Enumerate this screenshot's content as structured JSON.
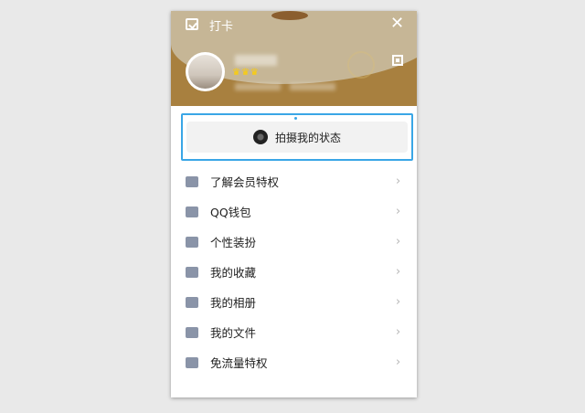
{
  "header": {
    "checkin_label": "打卡",
    "close_glyph": "✕",
    "crowns": "♛♛♛",
    "accent_color": "#a8803f"
  },
  "status": {
    "label": "拍摄我的状态",
    "border_color": "#3aa6e6"
  },
  "menu": {
    "items": [
      {
        "label": "了解会员特权",
        "icon": "vip-icon"
      },
      {
        "label": "QQ钱包",
        "icon": "wallet-icon"
      },
      {
        "label": "个性装扮",
        "icon": "shirt-icon"
      },
      {
        "label": "我的收藏",
        "icon": "bookmark-icon"
      },
      {
        "label": "我的相册",
        "icon": "photo-icon"
      },
      {
        "label": "我的文件",
        "icon": "folder-icon"
      },
      {
        "label": "免流量特权",
        "icon": "signal-icon"
      }
    ],
    "chevron": "›"
  }
}
